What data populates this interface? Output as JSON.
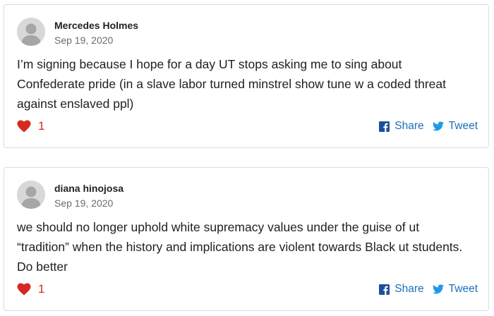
{
  "comments": [
    {
      "author": "Mercedes Holmes",
      "date": "Sep 19, 2020",
      "lines": [
        "I’m signing because I hope for a day UT stops asking me to sing about",
        "Confederate pride (in a slave labor turned minstrel show tune w a coded threat",
        "against enslaved ppl)"
      ],
      "likes": "1",
      "share_label": "Share",
      "tweet_label": "Tweet"
    },
    {
      "author": "diana hinojosa",
      "date": "Sep 19, 2020",
      "lines": [
        "we should no longer uphold white supremacy values under the guise of ut",
        "“tradition” when the history and implications are violent towards Black ut students.",
        "Do better"
      ],
      "likes": "1",
      "share_label": "Share",
      "tweet_label": "Tweet"
    }
  ],
  "colors": {
    "heart": "#d42a20",
    "link": "#1d6fba",
    "facebook": "#1d4f9c",
    "twitter": "#1d9be6",
    "avatar_bg": "#d8d8d8",
    "avatar_fg": "#a6a6a6"
  },
  "icons": {
    "avatar": "default-user-avatar",
    "like": "heart-icon",
    "share": "facebook-icon",
    "tweet": "twitter-bird-icon"
  }
}
